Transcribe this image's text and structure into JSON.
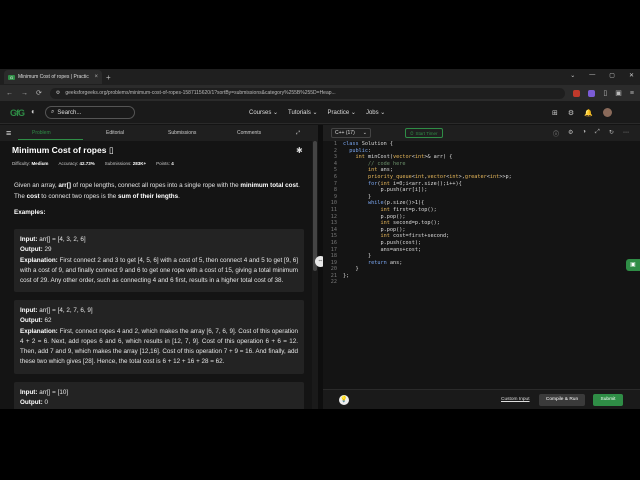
{
  "browser": {
    "tab_title": "Minimum Cost of ropes | Practic",
    "url": "geeksforgeeks.org/problems/minimum-cost-of-ropes-1587115620/1?sortBy=submissions&category%255B%255D=Heap..."
  },
  "header": {
    "logo": "GfG",
    "search_placeholder": "Search...",
    "nav": [
      "Courses",
      "Tutorials",
      "Practice",
      "Jobs"
    ]
  },
  "left_tabs": [
    "Problem",
    "Editorial",
    "Submissions",
    "Comments"
  ],
  "problem": {
    "title": "Minimum Cost of ropes",
    "meta": {
      "difficulty_label": "Difficulty:",
      "difficulty": "Medium",
      "accuracy_label": "Accuracy:",
      "accuracy": "42.73%",
      "submissions_label": "Submissions:",
      "submissions": "283K+",
      "points_label": "Points:",
      "points": "4"
    },
    "desc_1": "Given an array, ",
    "desc_2": "arr[]",
    "desc_3": " of rope lengths, connect all ropes into a single rope with the ",
    "desc_4": "minimum total cost",
    "desc_5": ". The ",
    "desc_6": "cost",
    "desc_7": " to connect two ropes is the ",
    "desc_8": "sum of their lengths",
    "desc_9": ".",
    "examples_label": "Examples:",
    "examples": [
      {
        "input_label": "Input:",
        "input": " arr[] = [4, 3, 2, 6]",
        "output_label": "Output:",
        "output": " 29",
        "expl_label": "Explanation:",
        "explanation": " First connect 2 and 3 to get [4, 5, 6] with a cost of 5, then connect 4 and 5 to get [9, 6] with a cost of 9, and finally connect 9 and 6 to get one rope with a cost of 15, giving a total minimum cost of 29. Any other order, such as connecting 4 and 6 first, results in a higher total cost of 38."
      },
      {
        "input_label": "Input:",
        "input": " arr[] = [4, 2, 7, 6, 9]",
        "output_label": "Output:",
        "output": " 62",
        "expl_label": "Explanation:",
        "explanation": " First, connect ropes 4 and 2, which makes the array [6, 7, 6, 9]. Cost of this operation 4 + 2 = 6. Next, add ropes 6 and 6, which results in [12, 7, 9]. Cost of this operation 6 + 6 = 12. Then, add 7 and 9, which makes the array [12,16]. Cost of this operation 7 + 9 = 16. And finally, add these two which gives [28]. Hence, the total cost is 6 + 12 + 16 + 28 = 62."
      },
      {
        "input_label": "Input:",
        "input": " arr[] = [10]",
        "output_label": "Output:",
        "output": " 0"
      }
    ]
  },
  "editor": {
    "language": "C++ (17)",
    "timer_label": "Start Timer",
    "code_lines": [
      "class Solution {",
      "  public:",
      "    int minCost(vector<int>& arr) {",
      "        // code here",
      "        int ans;",
      "        priority_queue<int,vector<int>,greater<int>>p;",
      "        for(int i=0;i<arr.size();i++){",
      "            p.push(arr[i]);",
      "        }",
      "        while(p.size()>1){",
      "            int first=p.top();",
      "            p.pop();",
      "            int second=p.top();",
      "            p.pop();",
      "            int cost=first+second;",
      "            p.push(cost);",
      "            ans=ans+cost;",
      "        }",
      "        return ans;",
      "    }",
      "};",
      ""
    ],
    "custom_input_label": "Custom Input",
    "compile_label": "Compile & Run",
    "submit_label": "Submit"
  },
  "colors": {
    "accent": "#2f8d46",
    "background": "#141414"
  }
}
